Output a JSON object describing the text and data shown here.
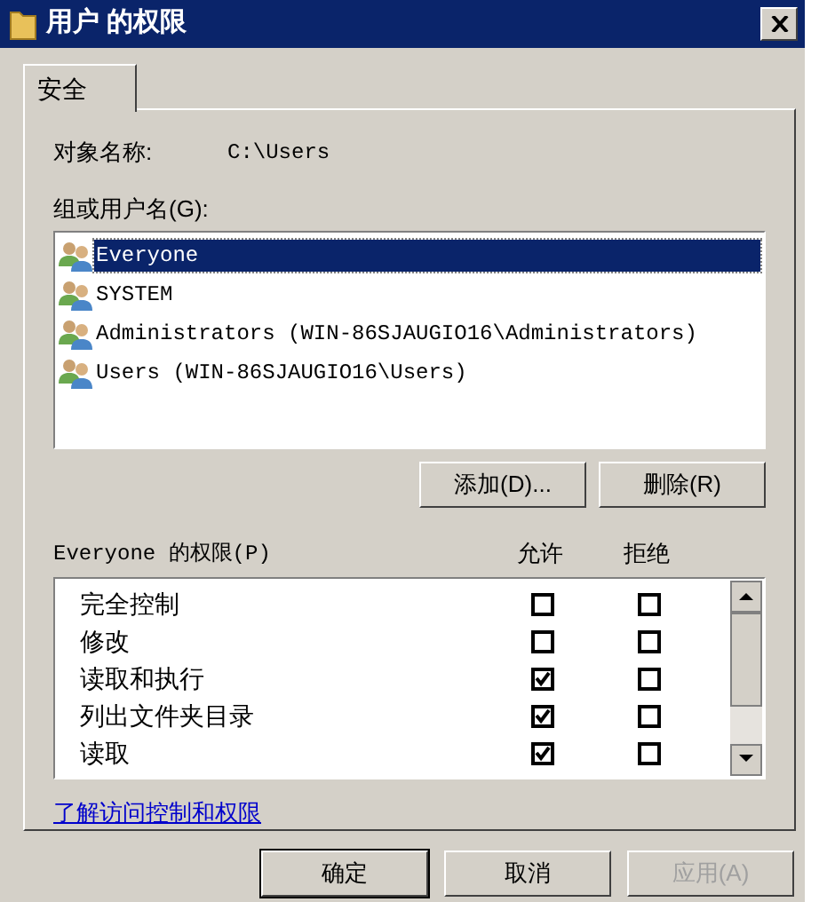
{
  "window": {
    "title": "用户 的权限"
  },
  "tabs": [
    {
      "label": "安全",
      "selected": true
    }
  ],
  "object_name": {
    "label": "对象名称:",
    "value": "C:\\Users"
  },
  "group_label": "组或用户名(G):",
  "principals": [
    {
      "name": "Everyone",
      "selected": true
    },
    {
      "name": "SYSTEM",
      "selected": false
    },
    {
      "name": "Administrators (WIN-86SJAUGIO16\\Administrators)",
      "selected": false
    },
    {
      "name": "Users (WIN-86SJAUGIO16\\Users)",
      "selected": false
    }
  ],
  "principal_buttons": [
    {
      "label": "添加(D)..."
    },
    {
      "label": "删除(R)"
    }
  ],
  "permissions": {
    "label": "Everyone 的权限(P)",
    "allow_header": "允许",
    "deny_header": "拒绝",
    "rows": [
      {
        "name": "完全控制",
        "allow": false,
        "deny": false
      },
      {
        "name": "修改",
        "allow": false,
        "deny": false
      },
      {
        "name": "读取和执行",
        "allow": true,
        "deny": false
      },
      {
        "name": "列出文件夹目录",
        "allow": true,
        "deny": false
      },
      {
        "name": "读取",
        "allow": true,
        "deny": false
      }
    ]
  },
  "link": "了解访问控制和权限",
  "dialog_buttons": [
    {
      "label": "确定",
      "default": true,
      "disabled": false
    },
    {
      "label": "取消",
      "default": false,
      "disabled": false
    },
    {
      "label": "应用(A)",
      "default": false,
      "disabled": true
    }
  ]
}
